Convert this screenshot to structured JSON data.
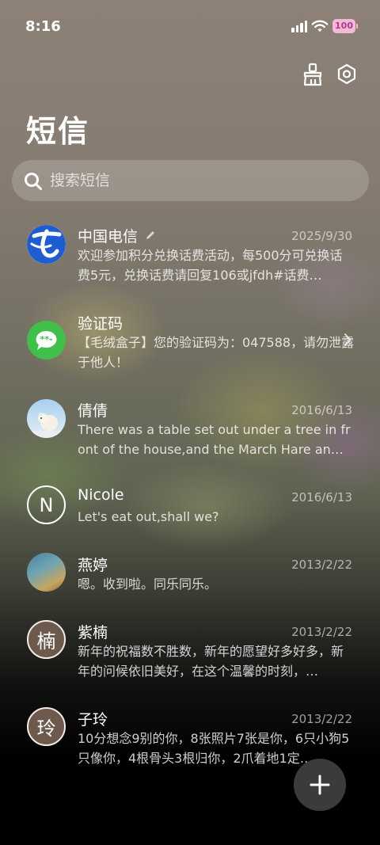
{
  "status_bar": {
    "time": "8:16",
    "battery": "100"
  },
  "header": {
    "title": "短信",
    "clean_icon": "broom-icon",
    "settings_icon": "hexagon-settings-icon"
  },
  "search": {
    "placeholder": "搜索短信",
    "icon": "search-icon"
  },
  "messages": [
    {
      "name": "中国电信",
      "date": "2025/9/30",
      "snippet": "欢迎参加积分兑换话费活动，每500分可兑换话费5元，兑换话费请回复106或jfdh#话费…",
      "avatar": "china-telecom-logo"
    },
    {
      "name": "验证码",
      "date": "",
      "snippet": "【毛绒盒子】您的验证码为：047588，请勿泄露于他人！",
      "avatar": "message-bubble-icon"
    },
    {
      "name": "倩倩",
      "date": "2016/6/13",
      "snippet": "There was a table set out under a tree in front of the house,and the March Hare an…",
      "avatar": "polar-bear-photo"
    },
    {
      "name": "Nicole",
      "date": "2016/6/13",
      "snippet": "Let's eat out,shall we?",
      "avatar_letter": "N"
    },
    {
      "name": "燕婷",
      "date": "2013/2/22",
      "snippet": "嗯。收到啦。同乐同乐。",
      "avatar": "landscape-photo"
    },
    {
      "name": "紫楠",
      "date": "2013/2/22",
      "snippet": "新年的祝福数不胜数，新年的愿望好多好多，新年的问候依旧美好，在这个温馨的时刻，…",
      "avatar_letter": "楠"
    },
    {
      "name": "子玲",
      "date": "2013/2/22",
      "snippet": "10分想念9别的你，8张照片7张是你，6只小狗5只像你，4根骨头3根归你，2爪着地1定…",
      "avatar_letter": "玲"
    }
  ],
  "fab": {
    "icon": "plus-icon"
  },
  "colors": {
    "telecom_blue": "#1e5cd1",
    "verify_green": "#3fc04a",
    "battery_pink": "#f3b9db"
  }
}
